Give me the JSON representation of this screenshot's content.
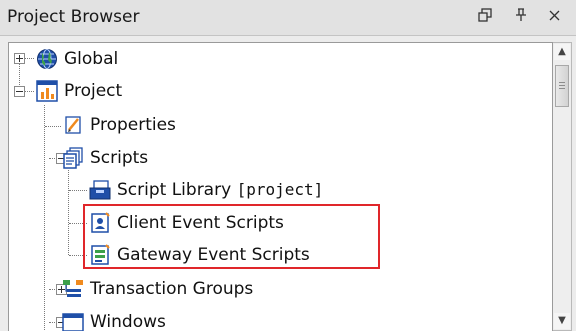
{
  "panel": {
    "title": "Project Browser",
    "controls": [
      {
        "name": "restore-window-icon",
        "glyph": "⧉"
      },
      {
        "name": "pin-icon",
        "glyph": "⫯"
      },
      {
        "name": "close-icon",
        "glyph": "×"
      }
    ]
  },
  "tree": {
    "global_label": "Global",
    "project_label": "Project",
    "properties_label": "Properties",
    "scripts_label": "Scripts",
    "script_library_label": "Script Library ",
    "script_library_suffix": "[project]",
    "client_event_scripts_label": "Client Event Scripts",
    "gateway_event_scripts_label": "Gateway Event Scripts",
    "transaction_groups_label": "Transaction Groups",
    "windows_label": "Windows"
  },
  "colors": {
    "highlight": "#e0262a",
    "accent_blue": "#1f4fa8",
    "accent_orange": "#f08a1e"
  }
}
